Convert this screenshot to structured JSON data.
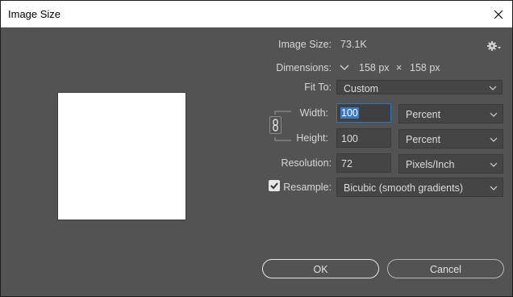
{
  "window": {
    "title": "Image Size"
  },
  "image_size": {
    "label": "Image Size:",
    "value": "73.1K"
  },
  "dimensions": {
    "label": "Dimensions:",
    "width": "158 px",
    "times": "×",
    "height": "158 px"
  },
  "fit_to": {
    "label": "Fit To:",
    "value": "Custom"
  },
  "width": {
    "label": "Width:",
    "value": "100",
    "unit": "Percent"
  },
  "height": {
    "label": "Height:",
    "value": "100",
    "unit": "Percent"
  },
  "resolution": {
    "label": "Resolution:",
    "value": "72",
    "unit": "Pixels/Inch"
  },
  "resample": {
    "label": "Resample:",
    "checked": true,
    "value": "Bicubic (smooth gradients)"
  },
  "buttons": {
    "ok": "OK",
    "cancel": "Cancel"
  },
  "colors": {
    "background": "#535353",
    "field": "#454545",
    "focus": "#2a78c2",
    "text": "#d6d6d6"
  }
}
